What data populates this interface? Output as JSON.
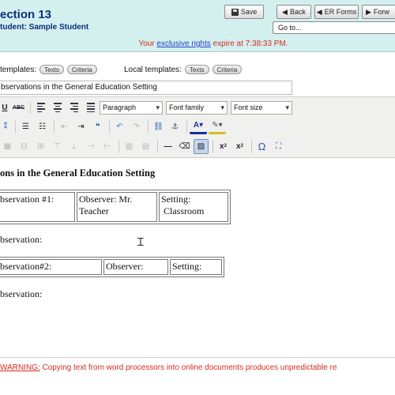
{
  "header": {
    "section_title": "ection 13",
    "student_line": "tudent: Sample Student",
    "save_label": "Save",
    "back_label": "Back",
    "er_forms_label": "ER Forms",
    "forward_label": "Forw",
    "goto_label": "Go to...",
    "expire_prefix": "Your",
    "expire_link": "exclusive rights",
    "expire_suffix": "expire at 7:38:33 PM."
  },
  "templates": {
    "label": "templates:",
    "texts_btn": "Texts",
    "criteria_btn": "Criteria",
    "local_label": "Local templates:",
    "local_texts_btn": "Texts",
    "local_criteria_btn": "Criteria"
  },
  "title_field": {
    "value": "bservations in the General Education Setting"
  },
  "toolbar": {
    "row1": {
      "underline": "U",
      "strike": "ABC",
      "format_select": "Paragraph",
      "font_family_select": "Font family",
      "font_size_select": "Font size"
    },
    "row3": {
      "sub": "x",
      "sup": "x",
      "omega": "Ω"
    },
    "colors": {
      "text_color": "#1a2e9a",
      "highlight": "#d4c020",
      "active_bg": "#c6d6ea"
    }
  },
  "document": {
    "heading": "ons in the General Education Setting",
    "table1": {
      "c1": "bservation #1:",
      "c2_line1": "Observer: Mr.",
      "c2_line2": "Teacher",
      "c3_line1": "Setting:",
      "c3_line2": "Classroom"
    },
    "obs_label_1": "bservation:",
    "table2": {
      "c1": "bservation#2:",
      "c2": "Observer:",
      "c3": "Setting:"
    },
    "obs_label_2": "bservation:"
  },
  "warning": {
    "label": "WARNING:",
    "text": " Copying text from word processors into online documents produces unpredictable re"
  }
}
